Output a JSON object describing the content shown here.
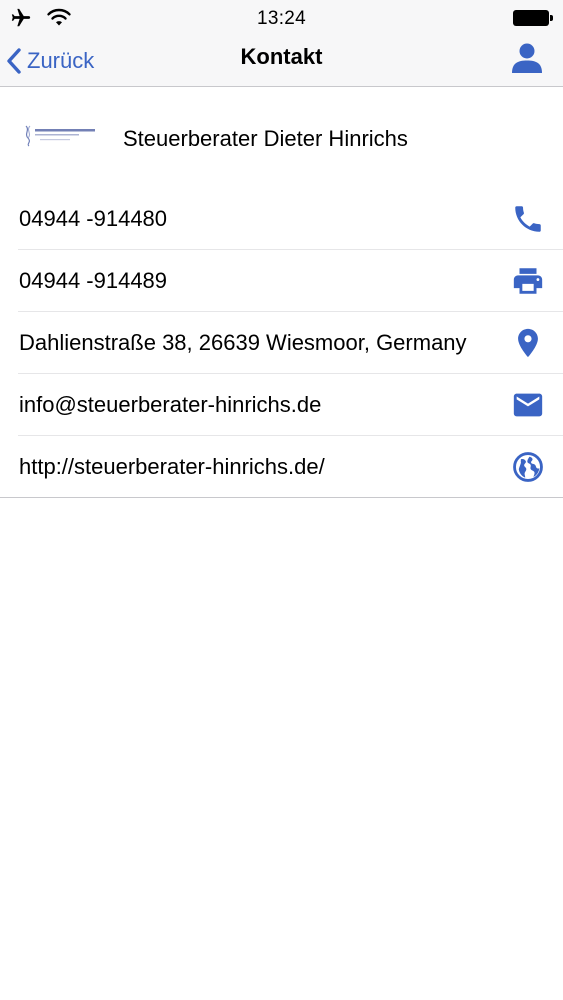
{
  "status_bar": {
    "time": "13:24",
    "icons": [
      "airplane-icon",
      "wifi-icon",
      "battery-icon"
    ]
  },
  "nav": {
    "back_label": "Zurück",
    "title": "Kontakt",
    "right_icon": "person-icon"
  },
  "company": {
    "name": "Steuerberater Dieter Hinrichs",
    "logo": "company-logo"
  },
  "contacts": [
    {
      "text": "04944 -914480",
      "icon": "phone-icon"
    },
    {
      "text": "04944 -914489",
      "icon": "printer-icon"
    },
    {
      "text": "Dahlienstraße 38, 26639 Wiesmoor, Germany",
      "icon": "map-pin-icon"
    },
    {
      "text": "info@steuerberater-hinrichs.de",
      "icon": "envelope-icon"
    },
    {
      "text": "http://steuerberater-hinrichs.de/",
      "icon": "globe-icon"
    }
  ],
  "colors": {
    "accent": "#3a64c4",
    "bar_background": "#f7f7f8",
    "separator": "#e6e6e8"
  }
}
